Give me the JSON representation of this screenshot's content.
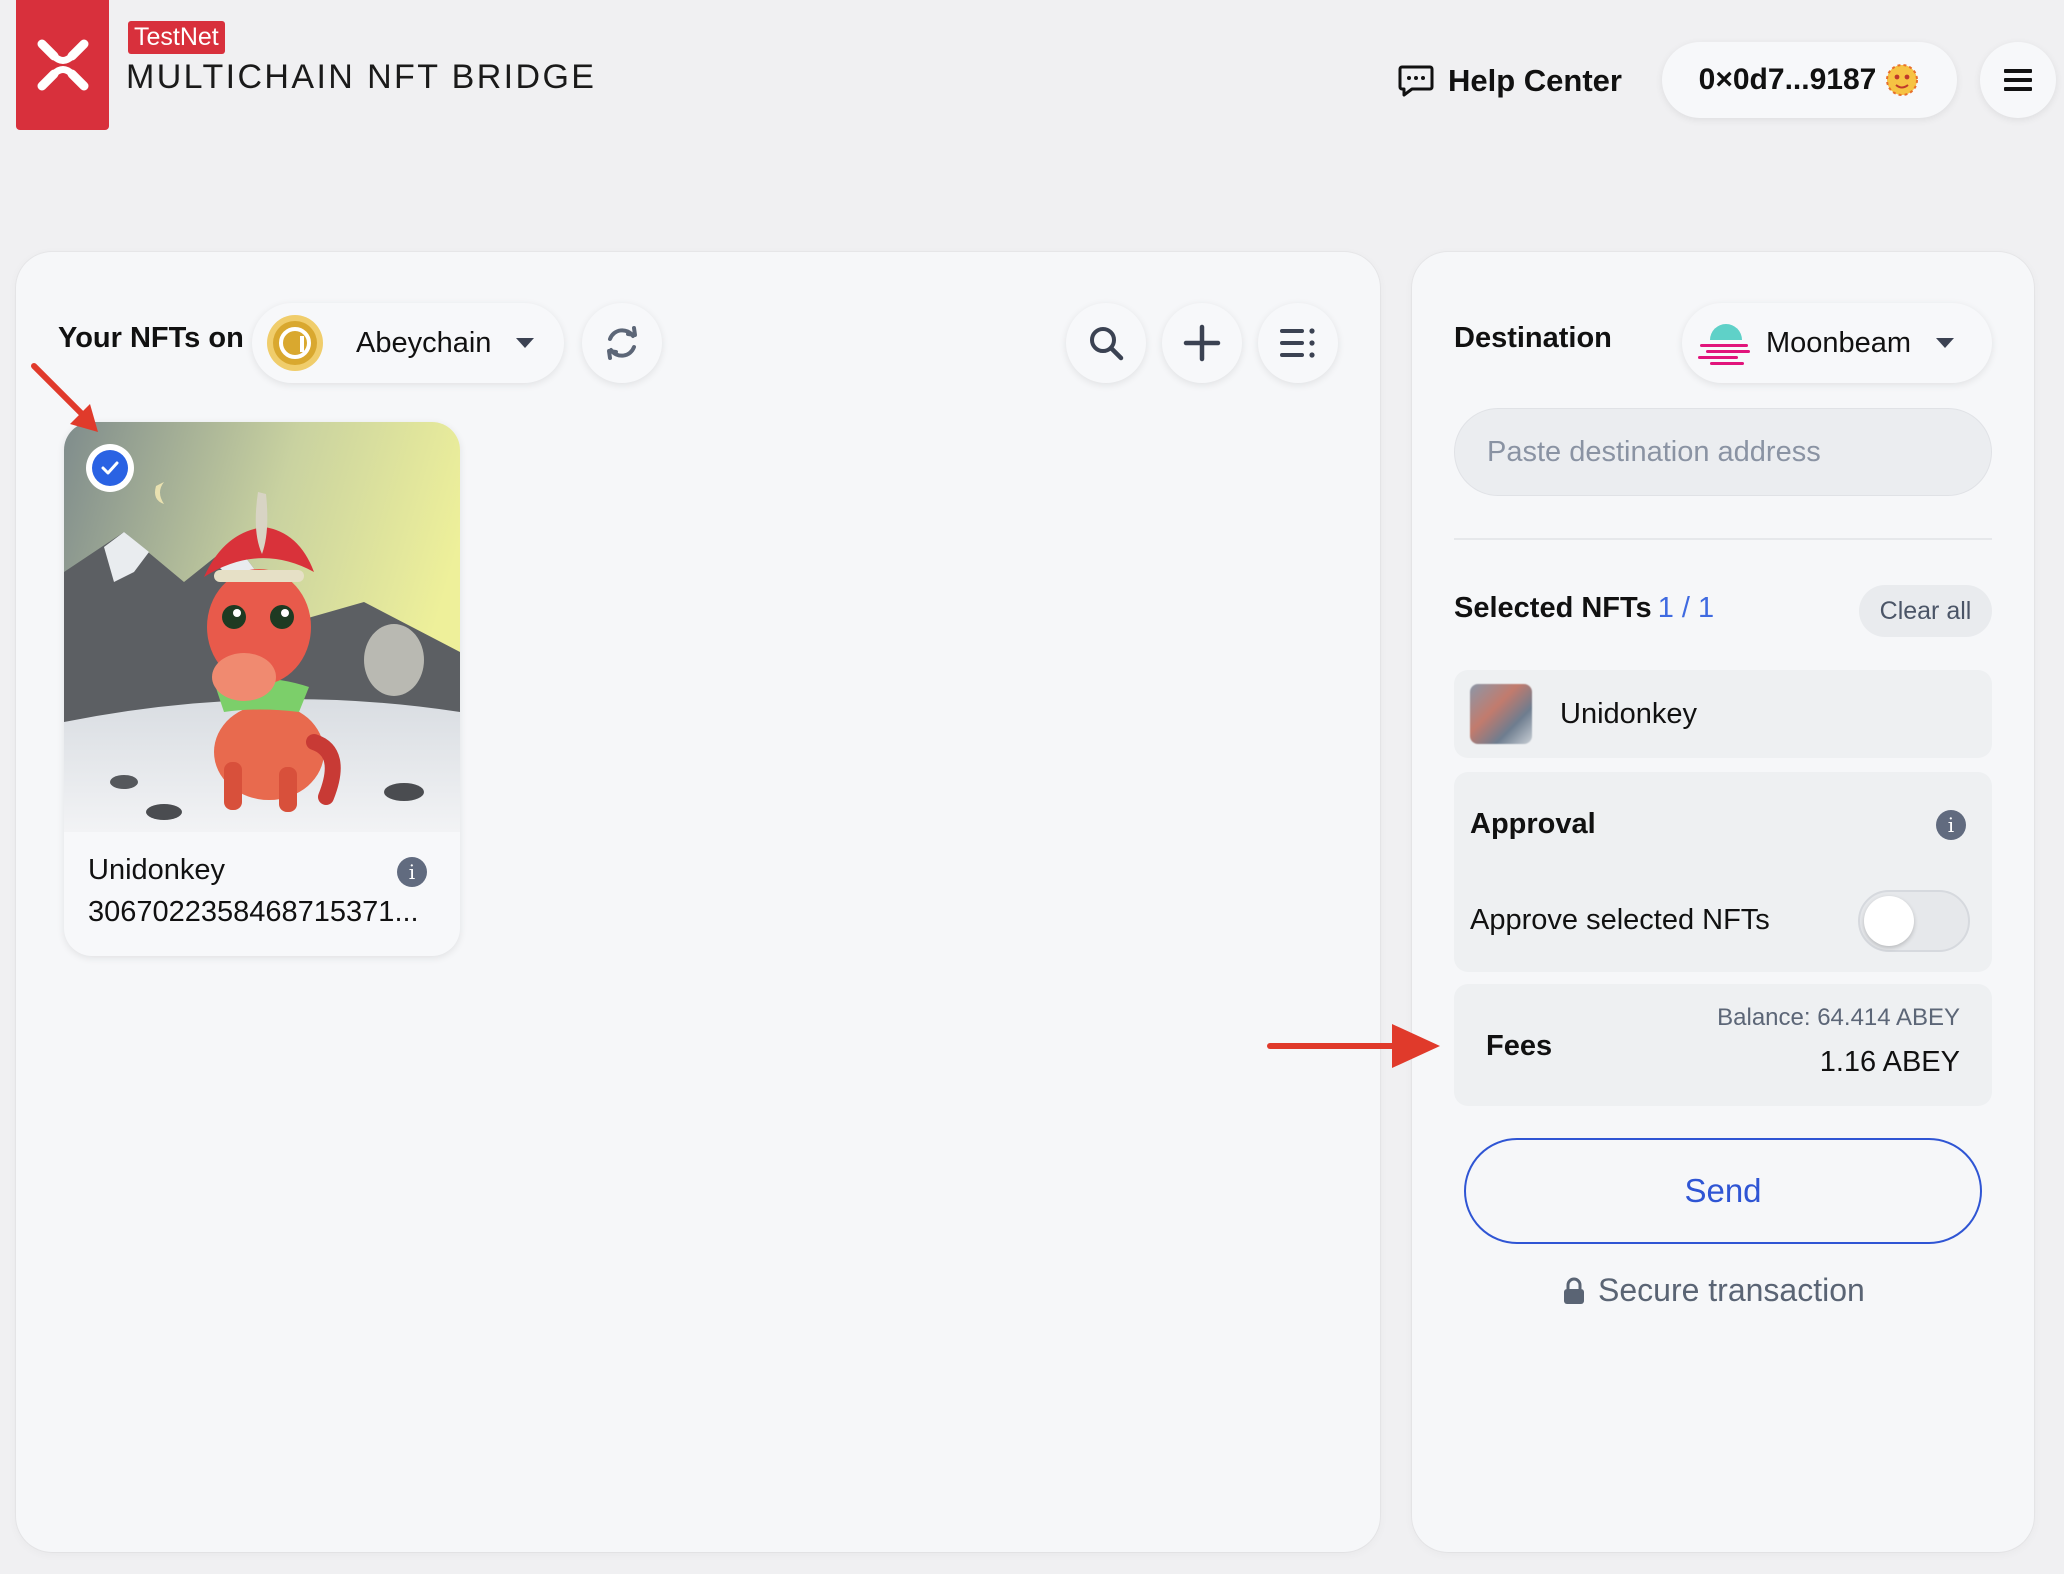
{
  "header": {
    "badge": "TestNet",
    "title": "MULTICHAIN NFT BRIDGE",
    "help_center": "Help Center",
    "wallet_address": "0×0d7...9187",
    "brand_color": "#d8303c"
  },
  "source": {
    "label": "Your NFTs on",
    "chain": "Abeychain",
    "icons": [
      "refresh-icon",
      "search-icon",
      "plus-icon",
      "list-filter-icon"
    ]
  },
  "nfts": [
    {
      "name": "Unidonkey",
      "token_id": "3067022358468715371...",
      "selected": true
    }
  ],
  "destination": {
    "label": "Destination",
    "chain": "Moonbeam",
    "address_placeholder": "Paste destination address",
    "address_value": ""
  },
  "selected": {
    "label": "Selected NFTs",
    "count": "1 / 1",
    "clear_all": "Clear all",
    "items": [
      {
        "name": "Unidonkey"
      }
    ]
  },
  "approval": {
    "title": "Approval",
    "approve_label": "Approve selected NFTs",
    "approved": false
  },
  "fees": {
    "label": "Fees",
    "balance": "Balance: 64.414 ABEY",
    "amount": "1.16 ABEY"
  },
  "send_label": "Send",
  "secure_label": "Secure transaction",
  "colors": {
    "accent": "#2f55d4",
    "annotation_arrow": "#e03a2b"
  }
}
